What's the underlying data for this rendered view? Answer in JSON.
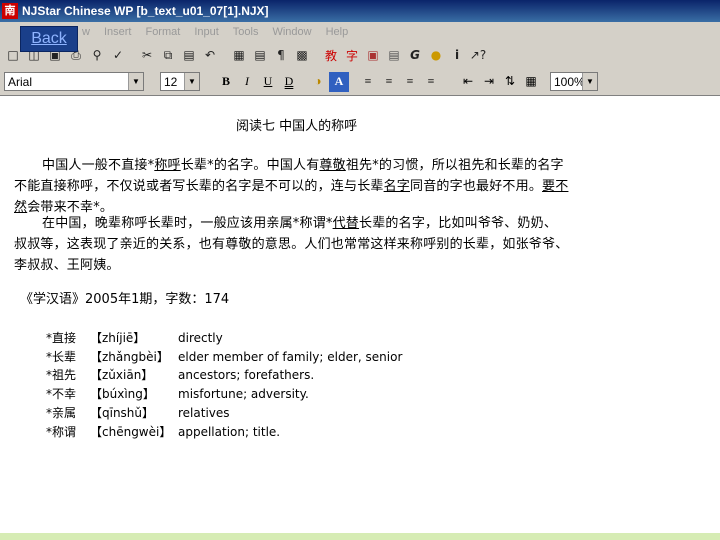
{
  "window": {
    "title": "NJStar Chinese WP    [b_text_u01_07[1].NJX]",
    "icon_glyph": "南"
  },
  "back_button": {
    "label": "Back"
  },
  "menu": [
    "w",
    "Insert",
    "Format",
    "Input",
    "Tools",
    "Window",
    "Help"
  ],
  "toolbar": {
    "font_name": "Arial",
    "font_size": "12",
    "zoom": "100%"
  },
  "document": {
    "title": "阅读七 中国人的称呼",
    "p1": {
      "a": "中国人一般不直接*",
      "b": "称呼",
      "c": "长辈*的名字。中国人有",
      "d": "尊敬",
      "e": "祖先*的习惯，所以祖先和长辈的名字不能直接称呼，不仅说或者写长辈的名字是不可以的，连与长辈",
      "f": "名字",
      "g": "同音的字也最好不用。",
      "h": "要不然",
      "i": "会带来不幸*。"
    },
    "p2": {
      "a": "在中国，晚辈称呼长辈时，一般应该用亲属*称谓*",
      "b": "代替",
      "c": "长辈的名字，比如叫爷爷、奶奶、叔叔等，这表现了亲近的关系，也有尊敬的意思。人们也常常这样来称呼别的长辈，如张爷爷、李叔叔、王阿姨。"
    },
    "source": "《学汉语》2005年1期，字数：174",
    "vocab": [
      {
        "word": "*直接",
        "pinyin": "【zhíjiē】",
        "meaning": "directly"
      },
      {
        "word": "*长辈",
        "pinyin": "【zhǎngbèi】",
        "meaning": "elder member of family; elder, senior"
      },
      {
        "word": "*祖先",
        "pinyin": "【zǔxiān】",
        "meaning": "ancestors; forefathers."
      },
      {
        "word": "*不幸",
        "pinyin": "【búxìng】",
        "meaning": "misfortune; adversity."
      },
      {
        "word": "*亲属",
        "pinyin": "【qīnshǔ】",
        "meaning": "relatives"
      },
      {
        "word": "*称谓",
        "pinyin": "【chēngwèi】",
        "meaning": "appellation; title."
      }
    ]
  },
  "colors": {
    "title_bar": "#0a246a",
    "chrome": "#d4d0c8",
    "back_button_bg": "#1a3f8a",
    "bottom_bar": "#d6ecb4"
  }
}
